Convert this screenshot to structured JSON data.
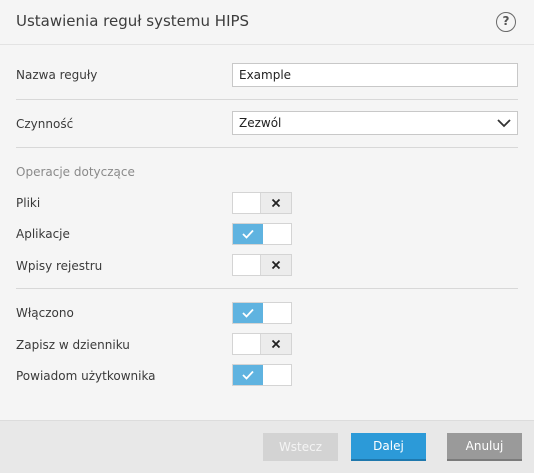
{
  "dialog": {
    "title": "Ustawienia reguł systemu HIPS",
    "help_label": "?"
  },
  "form": {
    "rule_name": {
      "label": "Nazwa reguły",
      "value": "Example"
    },
    "action": {
      "label": "Czynność",
      "selected": "Zezwól"
    },
    "operations_section": "Operacje dotyczące",
    "toggles": [
      {
        "label": "Pliki",
        "state": "off"
      },
      {
        "label": "Aplikacje",
        "state": "on"
      },
      {
        "label": "Wpisy rejestru",
        "state": "off"
      },
      {
        "label": "Włączono",
        "state": "on"
      },
      {
        "label": "Zapisz w dzienniku",
        "state": "off"
      },
      {
        "label": "Powiadom użytkownika",
        "state": "on"
      }
    ]
  },
  "footer": {
    "back_label": "Wstecz",
    "next_label": "Dalej",
    "cancel_label": "Anuluj"
  },
  "colors": {
    "accent": "#2c9ad8",
    "toggle_on": "#5fb3e0",
    "disabled_button": "#d3d3d3",
    "cancel_button": "#9a9a9a"
  }
}
